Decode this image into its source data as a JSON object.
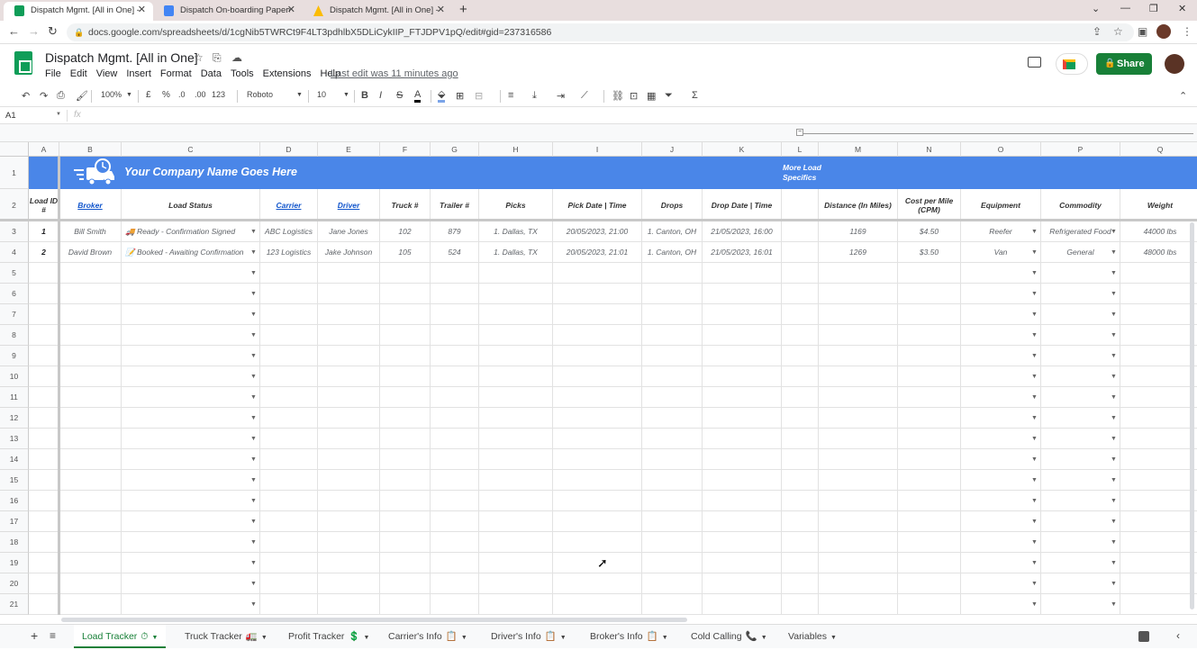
{
  "browser": {
    "tabs": [
      {
        "title": "Dispatch Mgmt. [All in One] - Go",
        "favicon": "sheets-icon",
        "color": "#0f9d58"
      },
      {
        "title": "Dispatch On-boarding Paperwor",
        "favicon": "docs-icon",
        "color": "#4285f4"
      },
      {
        "title": "Dispatch Mgmt. [All in One] - Ma",
        "favicon": "drive-icon",
        "color": "#fbbc04"
      }
    ],
    "url": "docs.google.com/spreadsheets/d/1cgNib5TWRCt9F4LT3pdhlbX5DLiCykIIP_FTJDPV1pQ/edit#gid=237316586"
  },
  "doc": {
    "title": "Dispatch Mgmt. [All in One]",
    "menu": [
      "File",
      "Edit",
      "View",
      "Insert",
      "Format",
      "Data",
      "Tools",
      "Extensions",
      "Help"
    ],
    "last_edit": "Last edit was 11 minutes ago",
    "share_label": "Share"
  },
  "toolbar": {
    "zoom": "100%",
    "currency": "£",
    "percent": "%",
    "dec_less": ".0",
    "dec_more": ".00",
    "number_format": "123",
    "font": "Roboto",
    "font_size": "10"
  },
  "formula_bar": {
    "name_box": "A1",
    "fx": "fx"
  },
  "columns": [
    "A",
    "B",
    "C",
    "D",
    "E",
    "F",
    "G",
    "H",
    "I",
    "J",
    "K",
    "L",
    "M",
    "N",
    "O",
    "P",
    "Q"
  ],
  "rows": [
    "1",
    "2",
    "3",
    "4",
    "5",
    "6",
    "7",
    "8",
    "9",
    "10",
    "11",
    "12",
    "13",
    "14",
    "15",
    "16",
    "17",
    "18",
    "19",
    "20",
    "21"
  ],
  "banner": {
    "company": "Your Company Name Goes Here",
    "more": "More Load Specifics",
    "color": "#4a86e8"
  },
  "headers": [
    "Load ID #",
    "Broker",
    "Load Status",
    "Carrier",
    "Driver",
    "Truck #",
    "Trailer #",
    "Picks",
    "Pick Date | Time",
    "Drops",
    "Drop Date | Time",
    "",
    "Distance (In Miles)",
    "Cost per Mile (CPM)",
    "Equipment",
    "Commodity",
    "Weight"
  ],
  "data_rows": [
    [
      "1",
      "Bill Smith",
      "🚚 Ready - Confirmation Signed",
      "ABC Logistics",
      "Jane Jones",
      "102",
      "879",
      "1. Dallas, TX",
      "20/05/2023, 21:00",
      "1. Canton, OH",
      "21/05/2023, 16:00",
      "",
      "1169",
      "$4.50",
      "Reefer",
      "Refrigerated Food",
      "44000 lbs"
    ],
    [
      "2",
      "David Brown",
      "📝 Booked - Awaiting Confirmation",
      "123 Logistics",
      "Jake Johnson",
      "105",
      "524",
      "1. Dallas, TX",
      "20/05/2023, 21:01",
      "1. Canton, OH",
      "21/05/2023, 16:01",
      "",
      "1269",
      "$3.50",
      "Van",
      "General",
      "48000 lbs"
    ]
  ],
  "sheet_tabs": [
    {
      "label": "Load Tracker",
      "emoji": "⏱",
      "active": true
    },
    {
      "label": "Truck Tracker",
      "emoji": "🚛",
      "active": false
    },
    {
      "label": "Profit Tracker",
      "emoji": "💲",
      "active": false
    },
    {
      "label": "Carrier's Info",
      "emoji": "📋",
      "active": false
    },
    {
      "label": "Driver's Info",
      "emoji": "📋",
      "active": false
    },
    {
      "label": "Broker's Info",
      "emoji": "📋",
      "active": false
    },
    {
      "label": "Cold Calling",
      "emoji": "📞",
      "active": false
    },
    {
      "label": "Variables",
      "emoji": "",
      "active": false
    }
  ],
  "colors": {
    "share": "#188038",
    "active_tab": "#188038",
    "link": "#1155cc"
  }
}
